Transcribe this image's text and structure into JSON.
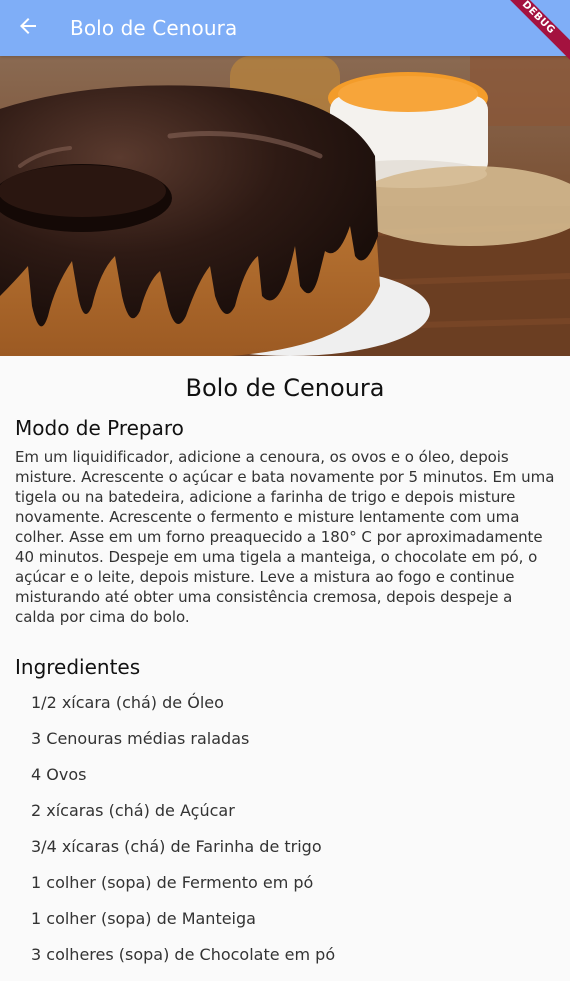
{
  "colors": {
    "app_bar": "#7faef7",
    "debug_ribbon": "#a4123f"
  },
  "app_bar": {
    "back_icon": "arrow-back-icon",
    "title": "Bolo de Cenoura",
    "debug_label": "DEBUG"
  },
  "hero": {
    "image": "chocolate-glazed-carrot-cake-photo"
  },
  "recipe": {
    "title": "Bolo de Cenoura",
    "preparation_heading": "Modo de Preparo",
    "preparation_text": "Em um liquidificador, adicione a cenoura, os ovos e o óleo, depois misture. Acrescente o açúcar e bata novamente por 5 minutos. Em uma tigela ou na batedeira, adicione a farinha de trigo e depois misture novamente. Acrescente o fermento e misture lentamente com uma colher. Asse em um forno preaquecido a 180° C por aproximadamente 40 minutos. Despeje em uma tigela a manteiga, o chocolate em pó, o açúcar e o leite, depois misture. Leve a mistura ao fogo e continue misturando até obter uma consistência cremosa, depois despeje a calda por cima do bolo.",
    "ingredients_heading": "Ingredientes",
    "ingredients": [
      "1/2 xícara (chá) de Óleo",
      "3 Cenouras médias raladas",
      "4 Ovos",
      "2 xícaras (chá) de Açúcar",
      "3/4 xícaras (chá) de Farinha de trigo",
      "1 colher (sopa) de Fermento em pó",
      "1 colher (sopa) de Manteiga",
      "3 colheres (sopa) de Chocolate em pó"
    ]
  }
}
